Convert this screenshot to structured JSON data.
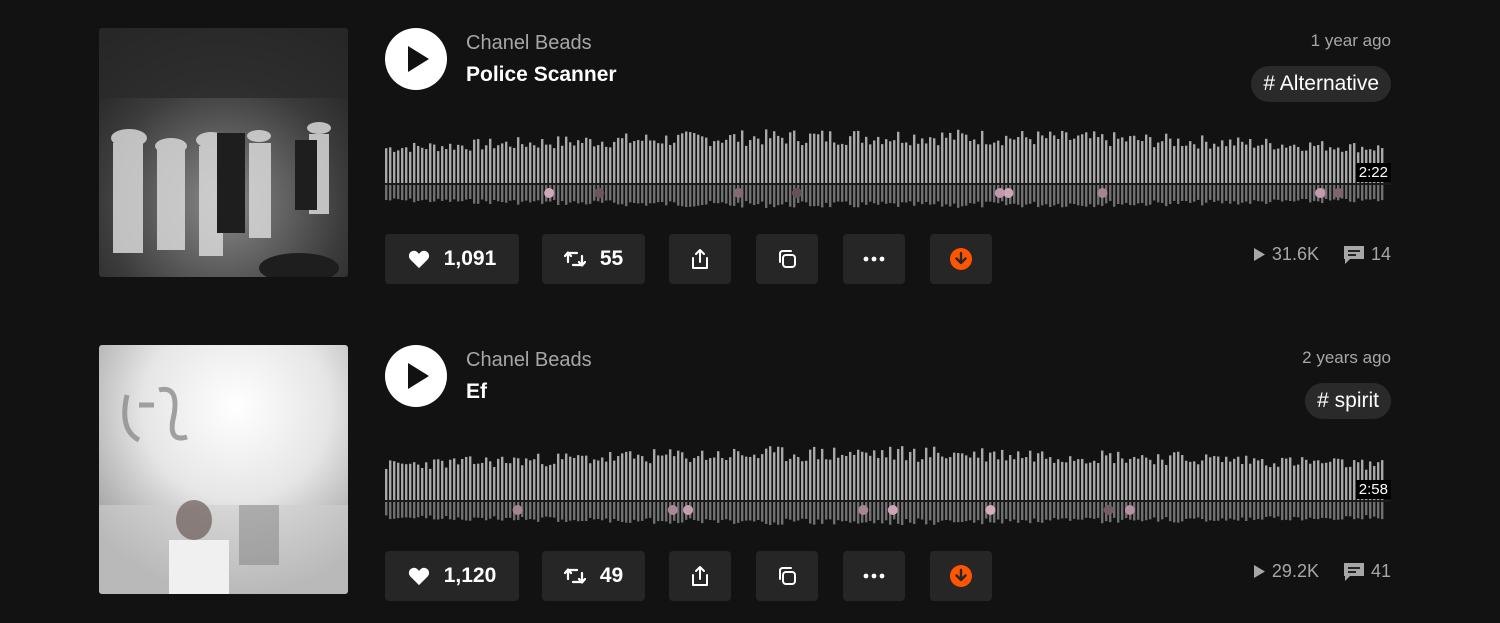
{
  "tracks": [
    {
      "artist": "Chanel Beads",
      "title": "Police Scanner",
      "posted": "1 year ago",
      "tag": "# Alternative",
      "duration": "2:22",
      "likes": "1,091",
      "reposts": "55",
      "plays": "31.6K",
      "comments": "14",
      "played_fraction": 0.0
    },
    {
      "artist": "Chanel Beads",
      "title": "Ef",
      "posted": "2 years ago",
      "tag": "# spirit",
      "duration": "2:58",
      "likes": "1,120",
      "reposts": "49",
      "plays": "29.2K",
      "comments": "41",
      "played_fraction": 0.0
    }
  ],
  "colors": {
    "background": "#121212",
    "button": "#262626",
    "accent": "#ff5500",
    "waveform": "#a9a9a9"
  },
  "icons": [
    "play-icon",
    "heart-icon",
    "repost-icon",
    "share-icon",
    "copy-icon",
    "more-icon",
    "download-icon",
    "plays-icon",
    "comment-icon"
  ]
}
